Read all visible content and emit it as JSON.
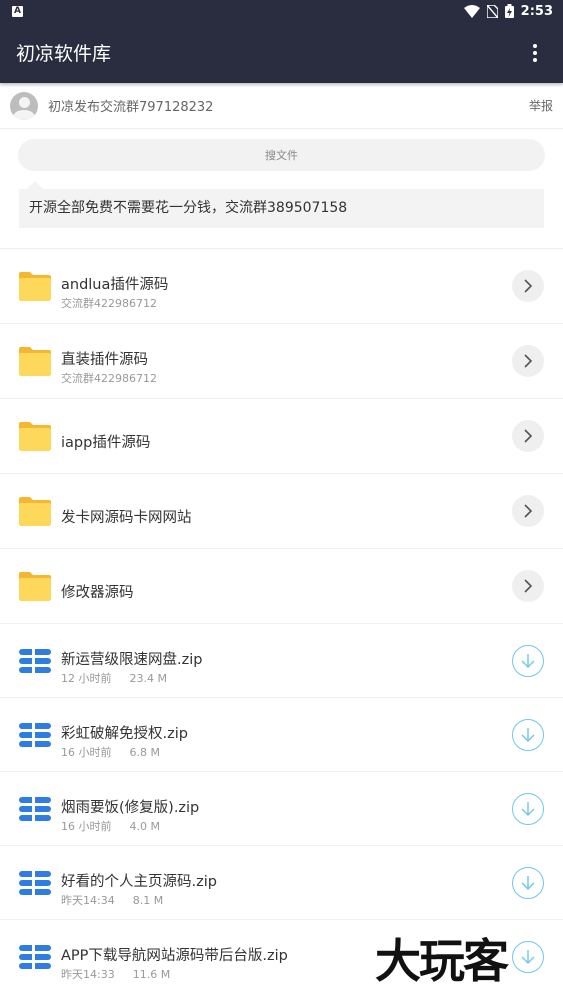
{
  "status_bar": {
    "time": "2:53",
    "badge": "A"
  },
  "app_bar": {
    "title": "初凉软件库"
  },
  "notice": {
    "text": "初凉发布交流群797128232",
    "report": "举报"
  },
  "search": {
    "placeholder": "搜文件"
  },
  "announcement": {
    "text": "开源全部免费不需要花一分钱，交流群389507158"
  },
  "folders": [
    {
      "title": "andlua插件源码",
      "subtitle": "交流群422986712"
    },
    {
      "title": "直装插件源码",
      "subtitle": "交流群422986712"
    },
    {
      "title": "iapp插件源码",
      "subtitle": ""
    },
    {
      "title": "发卡网源码卡网网站",
      "subtitle": ""
    },
    {
      "title": "修改器源码",
      "subtitle": ""
    }
  ],
  "files": [
    {
      "title": "新运营级限速网盘.zip",
      "time": "12 小时前",
      "size": "23.4 M"
    },
    {
      "title": "彩虹破解免授权.zip",
      "time": "16 小时前",
      "size": "6.8 M"
    },
    {
      "title": "烟雨要饭(修复版).zip",
      "time": "16 小时前",
      "size": "4.0 M"
    },
    {
      "title": "好看的个人主页源码.zip",
      "time": "昨天14:34",
      "size": "8.1 M"
    },
    {
      "title": "APP下载导航网站源码带后台版.zip",
      "time": "昨天14:33",
      "size": "11.6 M"
    }
  ],
  "watermark": "大玩客",
  "colors": {
    "app_bar": "#2a2d3f",
    "folder": "#fcd34d",
    "file_icon": "#2f7de1",
    "download_ring": "#6ec8ea"
  }
}
